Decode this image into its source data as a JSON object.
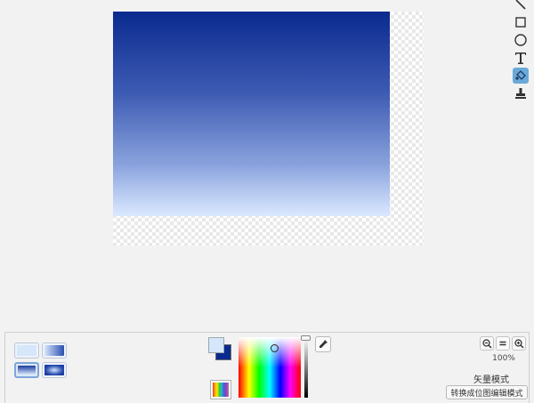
{
  "canvas": {
    "gradient_top_color": "#0a2a8f",
    "gradient_bottom_color": "#dbe9ff"
  },
  "tools": [
    {
      "name": "line-tool",
      "icon": "line-icon",
      "active": false
    },
    {
      "name": "rectangle-tool",
      "icon": "rectangle-icon",
      "active": false
    },
    {
      "name": "ellipse-tool",
      "icon": "ellipse-icon",
      "active": false
    },
    {
      "name": "text-tool",
      "icon": "text-icon",
      "active": false
    },
    {
      "name": "fill-tool",
      "icon": "paint-bucket-icon",
      "active": true
    },
    {
      "name": "stamp-tool",
      "icon": "stamp-icon",
      "active": false
    }
  ],
  "fill_options": [
    {
      "name": "solid",
      "selected": false
    },
    {
      "name": "horizontal-gradient",
      "selected": false
    },
    {
      "name": "vertical-gradient",
      "selected": true
    },
    {
      "name": "radial-gradient",
      "selected": false
    }
  ],
  "colors": {
    "primary": "#d6e6fb",
    "secondary": "#0a2a8f"
  },
  "zoom": {
    "level_text": "100%"
  },
  "mode": {
    "label": "矢量模式",
    "convert_button": "转换成位图编辑模式"
  }
}
